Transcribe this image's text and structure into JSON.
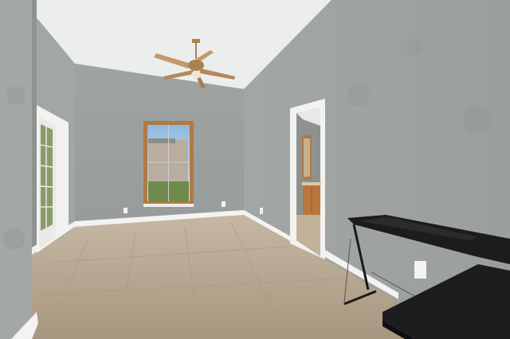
{
  "scene": {
    "description_hidden": "",
    "colors": {
      "wall_light": "#a7aaa9",
      "wall_mid": "#9a9e9d",
      "wall_shadow": "#8f9392",
      "ceiling": "#eef0ef",
      "floor": "#b9a993",
      "floor_dark": "#a08f78",
      "trim": "#f4f4f2",
      "window_frame": "#b07a45",
      "cabinet": "#b9773d",
      "desk": "#1c1c1e",
      "fan": "#b8926a"
    }
  }
}
